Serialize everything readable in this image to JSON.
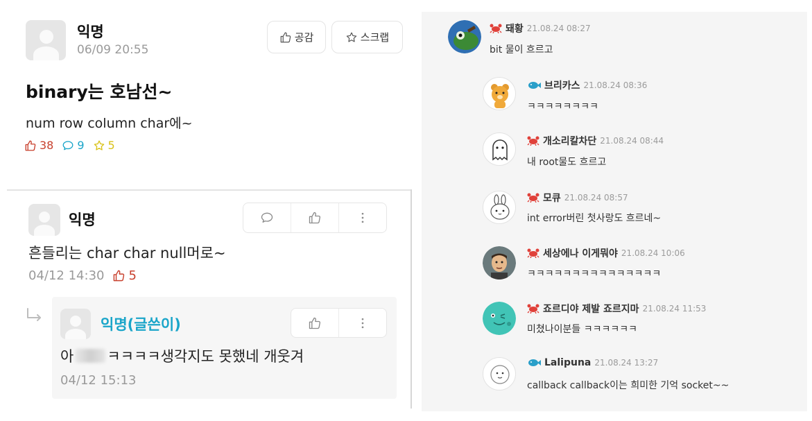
{
  "post": {
    "author": "익명",
    "time": "06/09 20:55",
    "like_button": "공감",
    "scrap_button": "스크랩",
    "title": "binary는 호남선~",
    "body": "num row column char에~",
    "stats": {
      "likes": "38",
      "comments": "9",
      "scraps": "5"
    }
  },
  "comment": {
    "author": "익명",
    "text": "흔들리는 char char null머로~",
    "time": "04/12 14:30",
    "likes": "5"
  },
  "reply": {
    "author": "익명(글쓴이)",
    "text_before": "아",
    "text_after": "ㅋㅋㅋㅋ생각지도 못했네 개웃겨",
    "time": "04/12 15:13"
  },
  "thread": [
    {
      "nick": "돼황",
      "time": "21.08.24 08:27",
      "text": "bit 물이 흐르고",
      "level_icon": "crab-icon",
      "avatar": "frog-avatar"
    },
    {
      "nick": "브리카스",
      "time": "21.08.24 08:36",
      "text": "ㅋㅋㅋㅋㅋㅋㅋㅋ",
      "level_icon": "fish-icon",
      "avatar": "bear-avatar"
    },
    {
      "nick": "개소리칼차단",
      "time": "21.08.24 08:44",
      "text": "내 root물도 흐르고",
      "level_icon": "crab-icon",
      "avatar": "ghost-avatar"
    },
    {
      "nick": "모큐",
      "time": "21.08.24 08:57",
      "text": "int error버린 첫사랑도 흐르네~",
      "level_icon": "crab-icon",
      "avatar": "bunny-avatar"
    },
    {
      "nick": "세상에나 이게뭐야",
      "time": "21.08.24 10:06",
      "text": "ㅋㅋㅋㅋㅋㅋㅋㅋㅋㅋㅋㅋㅋㅋㅋ",
      "level_icon": "crab-icon",
      "avatar": "man-avatar"
    },
    {
      "nick": "죠르디야 제발 죠르지마",
      "time": "21.08.24 11:53",
      "text": "미쳤나이분들 ㅋㅋㅋㅋㅋㅋ",
      "level_icon": "crab-icon",
      "avatar": "dino-avatar"
    },
    {
      "nick": "Lalipuna",
      "time": "21.08.24 13:27",
      "text": "callback callback이는 희미한 기억 socket~~",
      "level_icon": "fish-icon",
      "avatar": "default-avatar"
    }
  ],
  "colors": {
    "like": "#c8402d",
    "comment": "#1aa5c9",
    "scrap": "#d9c21a",
    "writer": "#1aa5c9",
    "crab": "#e0413a",
    "fish": "#2a9fc9"
  }
}
